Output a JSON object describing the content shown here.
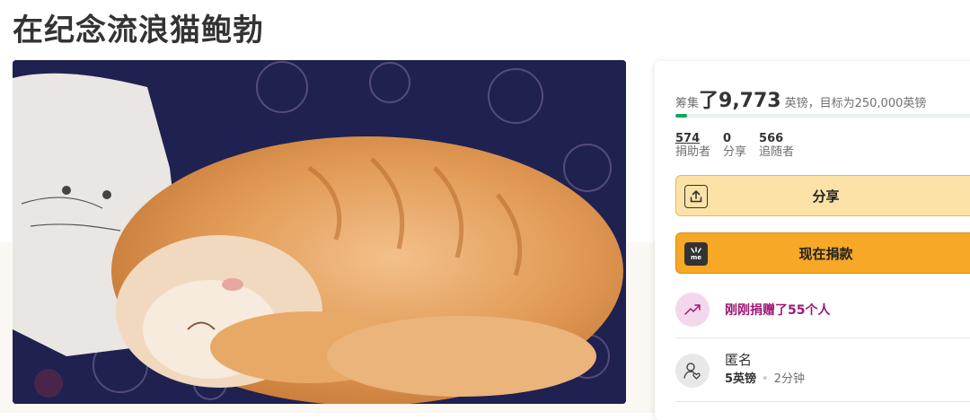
{
  "page": {
    "title": "在纪念流浪猫鲍勃"
  },
  "campaign": {
    "raised_prefix": "筹集",
    "raised_amount": "了9,773",
    "raised_suffix": "英镑，目标为250,000英镑",
    "progress_fraction": 0.039,
    "colors": {
      "progress": "#02a95c",
      "share": "#fde2a7",
      "donate": "#f7a826",
      "recent": "#9c1874"
    }
  },
  "stats": [
    {
      "value": "574",
      "label": "捐助者"
    },
    {
      "value": "0",
      "label": "分享"
    },
    {
      "value": "566",
      "label": "追随者"
    }
  ],
  "buttons": {
    "share_label": "分享",
    "share_icon": "share-upload-icon",
    "donate_label": "现在捐款",
    "donate_icon": "gofundme-logo-icon"
  },
  "recent": {
    "text": "刚刚捐赠了55个人",
    "icon": "trending-up-icon"
  },
  "donation": {
    "name": "匿名",
    "amount": "5英镑",
    "time": "2分钟",
    "icon": "user-heart-icon"
  }
}
